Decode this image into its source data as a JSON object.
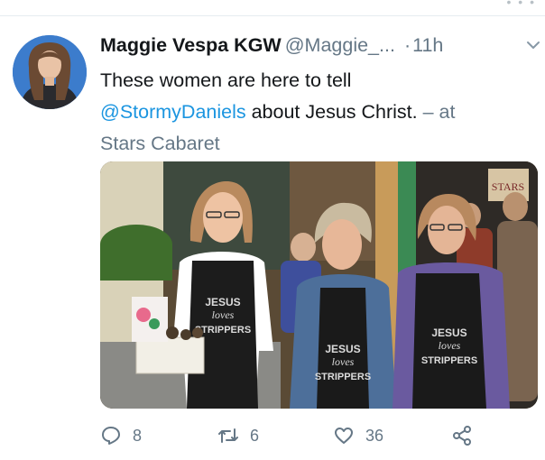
{
  "tweet": {
    "display_name": "Maggie Vespa KGW",
    "handle": "@Maggie_...",
    "separator": "·",
    "time": "11h",
    "text_line1": "These women are here to tell",
    "mention": "@StormyDaniels",
    "text_after_mention": " about Jesus Christ.",
    "location_prefix": " – at",
    "location": "Stars Cabaret"
  },
  "photo": {
    "shirt_text": [
      "JESUS",
      "loves",
      "STRIPPERS"
    ],
    "sign_text": "STARS"
  },
  "actions": {
    "replies": "8",
    "retweets": "6",
    "likes": "36"
  },
  "colors": {
    "link": "#1b95e0",
    "secondary_text": "#657786",
    "primary_text": "#14171a"
  }
}
